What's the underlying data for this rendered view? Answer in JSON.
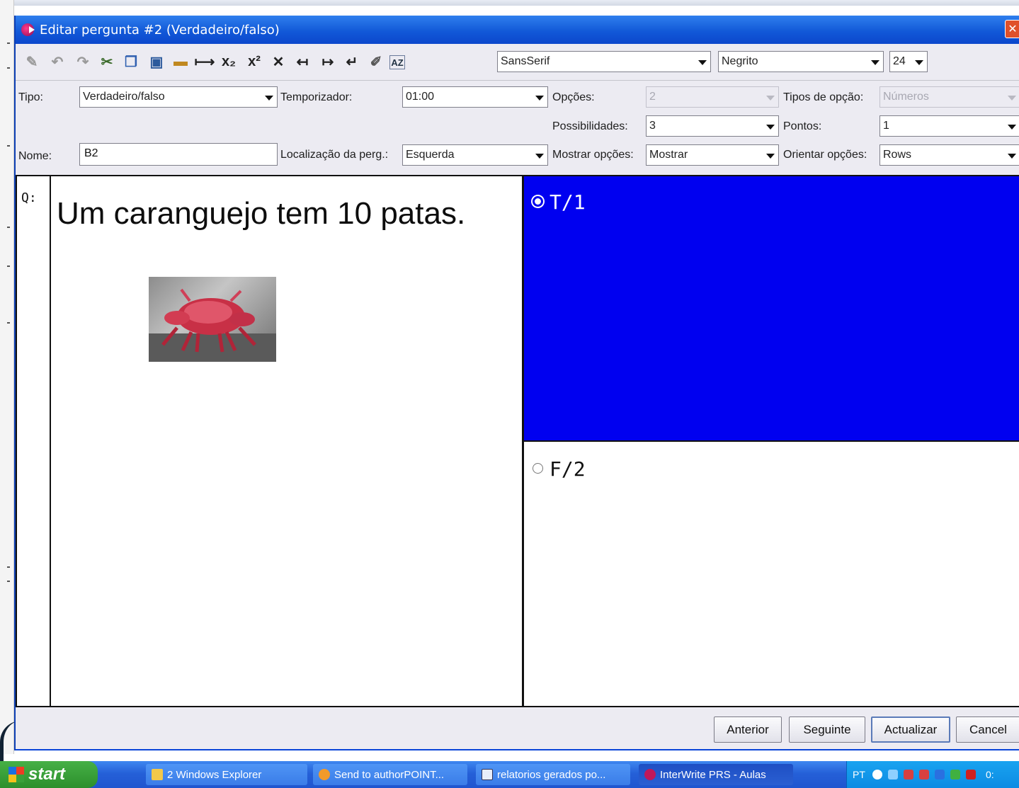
{
  "window": {
    "title": "Editar pergunta #2 (Verdadeiro/falso)"
  },
  "toolbar": {
    "icons": [
      "edit-icon",
      "undo-icon",
      "redo-icon",
      "cut-icon",
      "copy-icon",
      "paste-icon",
      "image-icon",
      "line-icon",
      "subscript-icon",
      "superscript-icon",
      "clear-format-icon",
      "indent-left-icon",
      "indent-right-icon",
      "enter-icon",
      "edit-pencil-icon",
      "sort-az-icon"
    ],
    "font": "SansSerif",
    "style": "Negrito",
    "size": "24"
  },
  "form": {
    "tipo_label": "Tipo:",
    "tipo_value": "Verdadeiro/falso",
    "temporizador_label": "Temporizador:",
    "temporizador_value": "01:00",
    "opcoes_label": "Opções:",
    "opcoes_value": "2",
    "tipos_opcao_label": "Tipos de opção:",
    "tipos_opcao_value": "Números",
    "possibilidades_label": "Possibilidades:",
    "possibilidades_value": "3",
    "pontos_label": "Pontos:",
    "pontos_value": "1",
    "nome_label": "Nome:",
    "nome_value": "B2",
    "localizacao_label": "Localização da perg.:",
    "localizacao_value": "Esquerda",
    "mostrar_label": "Mostrar opções:",
    "mostrar_value": "Mostrar",
    "orientar_label": "Orientar opções:",
    "orientar_value": "Rows"
  },
  "question": {
    "label": "Q:",
    "text": "Um caranguejo tem 10 patas."
  },
  "options": [
    {
      "text": "T/1",
      "selected": true,
      "bg": "#0000f0"
    },
    {
      "text": "F/2",
      "selected": false,
      "bg": "#ffffff"
    }
  ],
  "buttons": {
    "anterior": "Anterior",
    "seguinte": "Seguinte",
    "actualizar": "Actualizar",
    "cancel": "Cancel"
  },
  "taskbar": {
    "start": "start",
    "tasks": [
      "2 Windows Explorer",
      "Send to authorPOINT...",
      "relatorios gerados po...",
      "InterWrite PRS - Aulas"
    ],
    "tray_lang": "PT",
    "tray_clock": "0:"
  }
}
